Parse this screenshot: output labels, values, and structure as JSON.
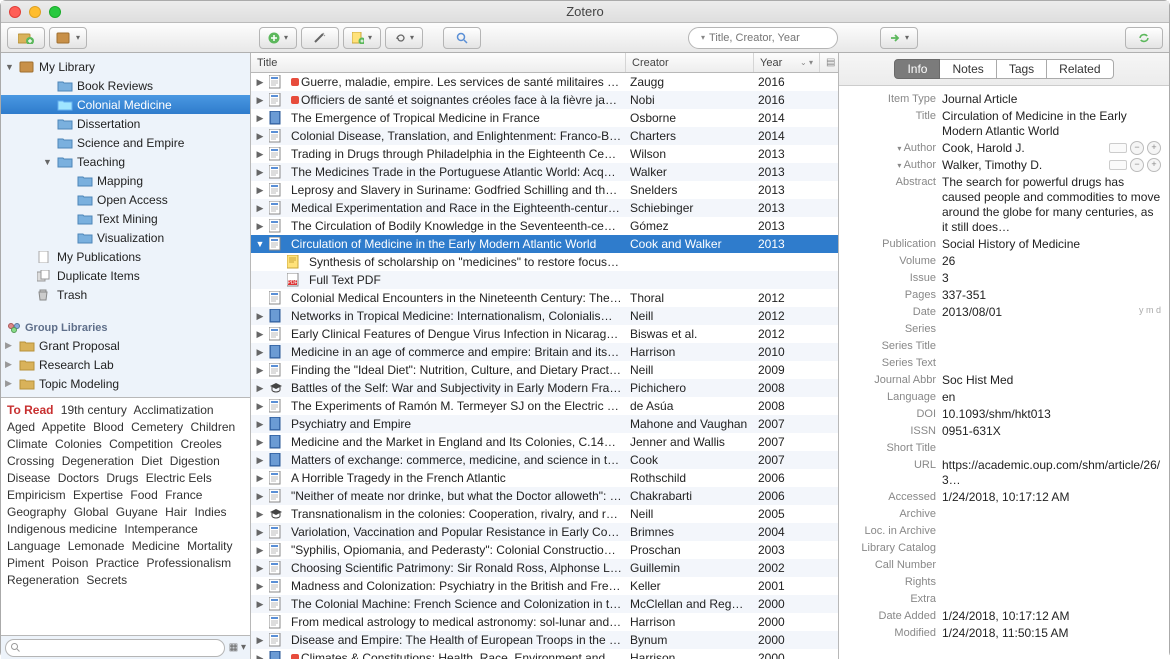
{
  "window_title": "Zotero",
  "toolbar_search_placeholder": "Title, Creator, Year",
  "sidebar": {
    "my_library": "My Library",
    "items": [
      {
        "label": "Book Reviews",
        "depth": 2
      },
      {
        "label": "Colonial Medicine",
        "depth": 2,
        "selected": true
      },
      {
        "label": "Dissertation",
        "depth": 2
      },
      {
        "label": "Science and Empire",
        "depth": 2
      },
      {
        "label": "Teaching",
        "depth": 2,
        "expanded": true
      },
      {
        "label": "Mapping",
        "depth": 3
      },
      {
        "label": "Open Access",
        "depth": 3
      },
      {
        "label": "Text Mining",
        "depth": 3
      },
      {
        "label": "Visualization",
        "depth": 3
      }
    ],
    "my_publications": "My Publications",
    "duplicate_items": "Duplicate Items",
    "trash": "Trash",
    "group_libraries_header": "Group Libraries",
    "groups": [
      {
        "label": "Grant Proposal"
      },
      {
        "label": "Research Lab"
      },
      {
        "label": "Topic Modeling"
      }
    ]
  },
  "tags": [
    "To Read",
    "19th century",
    "Acclimatization",
    "Aged",
    "Appetite",
    "Blood",
    "Cemetery",
    "Children",
    "Climate",
    "Colonies",
    "Competition",
    "Creoles",
    "Crossing",
    "Degeneration",
    "Diet",
    "Digestion",
    "Disease",
    "Doctors",
    "Drugs",
    "Electric Eels",
    "Empiricism",
    "Expertise",
    "Food",
    "France",
    "Geography",
    "Global",
    "Guyane",
    "Hair",
    "Indies",
    "Indigenous medicine",
    "Intemperance",
    "Language",
    "Lemonade",
    "Medicine",
    "Mortality",
    "Piment",
    "Poison",
    "Practice",
    "Professionalism",
    "Regeneration",
    "Secrets"
  ],
  "columns": {
    "title": "Title",
    "creator": "Creator",
    "year": "Year"
  },
  "items": [
    {
      "title": "Guerre, maladie, empire. Les services de santé militaires en …",
      "creator": "Zaugg",
      "year": "2016",
      "icon": "article",
      "dot": true,
      "twisty": true
    },
    {
      "title": "Officiers de santé et soignantes créoles face à la fièvre jaune",
      "creator": "Nobi",
      "year": "2016",
      "icon": "article",
      "dot": true,
      "twisty": true
    },
    {
      "title": "The Emergence of Tropical Medicine in France",
      "creator": "Osborne",
      "year": "2014",
      "icon": "book",
      "twisty": true
    },
    {
      "title": "Colonial Disease, Translation, and Enlightenment: Franco-Briti…",
      "creator": "Charters",
      "year": "2014",
      "icon": "article",
      "twisty": true
    },
    {
      "title": "Trading in Drugs through Philadelphia in the Eighteenth Centu…",
      "creator": "Wilson",
      "year": "2013",
      "icon": "article",
      "twisty": true
    },
    {
      "title": "The Medicines Trade in the Portuguese Atlantic World: Acquisi…",
      "creator": "Walker",
      "year": "2013",
      "icon": "article",
      "twisty": true
    },
    {
      "title": "Leprosy and Slavery in Suriname: Godfried Schilling and the Fr…",
      "creator": "Snelders",
      "year": "2013",
      "icon": "article",
      "twisty": true
    },
    {
      "title": "Medical Experimentation and Race in the Eighteenth-century …",
      "creator": "Schiebinger",
      "year": "2013",
      "icon": "article",
      "twisty": true
    },
    {
      "title": "The Circulation of Bodily Knowledge in the Seventeenth-centu…",
      "creator": "Gómez",
      "year": "2013",
      "icon": "article",
      "twisty": true
    },
    {
      "title": "Circulation of Medicine in the Early Modern Atlantic World",
      "creator": "Cook and Walker",
      "year": "2013",
      "icon": "article",
      "twisty": true,
      "expanded": true,
      "selected": true
    },
    {
      "title": "Synthesis of scholarship on \"medicines\" to restore focus o…",
      "creator": "",
      "year": "",
      "icon": "note",
      "child": true
    },
    {
      "title": "Full Text PDF",
      "creator": "",
      "year": "",
      "icon": "pdf",
      "child": true
    },
    {
      "title": "Colonial Medical Encounters in the Nineteenth Century: The Fr…",
      "creator": "Thoral",
      "year": "2012",
      "icon": "article"
    },
    {
      "title": "Networks in Tropical Medicine: Internationalism, Colonialism, a…",
      "creator": "Neill",
      "year": "2012",
      "icon": "book",
      "twisty": true
    },
    {
      "title": "Early Clinical Features of Dengue Virus Infection in Nicaraguan…",
      "creator": "Biswas et al.",
      "year": "2012",
      "icon": "article",
      "twisty": true
    },
    {
      "title": "Medicine in an age of commerce and empire: Britain and its tr…",
      "creator": "Harrison",
      "year": "2010",
      "icon": "book",
      "twisty": true
    },
    {
      "title": "Finding the \"Ideal Diet\": Nutrition, Culture, and Dietary Practic…",
      "creator": "Neill",
      "year": "2009",
      "icon": "article",
      "twisty": true
    },
    {
      "title": "Battles of the Self: War and Subjectivity in Early Modern France",
      "creator": "Pichichero",
      "year": "2008",
      "icon": "thesis",
      "twisty": true
    },
    {
      "title": "The Experiments of Ramón M. Termeyer SJ on the Electric Eel …",
      "creator": "de Asúa",
      "year": "2008",
      "icon": "article",
      "twisty": true
    },
    {
      "title": "Psychiatry and Empire",
      "creator": "Mahone and Vaughan",
      "year": "2007",
      "icon": "book",
      "twisty": true
    },
    {
      "title": "Medicine and the Market in England and Its Colonies, C.1450-…",
      "creator": "Jenner and Wallis",
      "year": "2007",
      "icon": "book",
      "twisty": true
    },
    {
      "title": "Matters of exchange: commerce, medicine, and science in the…",
      "creator": "Cook",
      "year": "2007",
      "icon": "book",
      "twisty": true
    },
    {
      "title": "A Horrible Tragedy in the French Atlantic",
      "creator": "Rothschild",
      "year": "2006",
      "icon": "article",
      "twisty": true
    },
    {
      "title": "\"Neither of meate nor drinke, but what the Doctor alloweth\": …",
      "creator": "Chakrabarti",
      "year": "2006",
      "icon": "article",
      "twisty": true
    },
    {
      "title": "Transnationalism in the colonies: Cooperation, rivalry, and rac…",
      "creator": "Neill",
      "year": "2005",
      "icon": "thesis",
      "twisty": true
    },
    {
      "title": "Variolation, Vaccination and Popular Resistance in Early Coloni…",
      "creator": "Brimnes",
      "year": "2004",
      "icon": "article",
      "twisty": true
    },
    {
      "title": "\"Syphilis, Opiomania, and Pederasty\": Colonial Constructions …",
      "creator": "Proschan",
      "year": "2003",
      "icon": "article",
      "twisty": true
    },
    {
      "title": "Choosing Scientific Patrimony: Sir Ronald Ross, Alphonse Lav…",
      "creator": "Guillemin",
      "year": "2002",
      "icon": "article",
      "twisty": true
    },
    {
      "title": "Madness and Colonization: Psychiatry in the British and Frenc…",
      "creator": "Keller",
      "year": "2001",
      "icon": "article",
      "twisty": true
    },
    {
      "title": "The Colonial Machine: French Science and Colonization in the …",
      "creator": "McClellan and Rego…",
      "year": "2000",
      "icon": "article",
      "twisty": true
    },
    {
      "title": "From medical astrology to medical astronomy: sol-lunar and pl…",
      "creator": "Harrison",
      "year": "2000",
      "icon": "article"
    },
    {
      "title": "Disease and Empire: The Health of European Troops in the Co…",
      "creator": "Bynum",
      "year": "2000",
      "icon": "article",
      "twisty": true
    },
    {
      "title": "Climates & Constitutions: Health, Race, Environment and …",
      "creator": "Harrison",
      "year": "2000",
      "icon": "book",
      "dot": true,
      "twisty": true
    }
  ],
  "detail": {
    "tabs": {
      "info": "Info",
      "notes": "Notes",
      "tags": "Tags",
      "related": "Related"
    },
    "fields": {
      "item_type": {
        "label": "Item Type",
        "value": "Journal Article"
      },
      "title": {
        "label": "Title",
        "value": "Circulation of Medicine in the Early Modern Atlantic World"
      },
      "author1": {
        "label": "Author",
        "value": "Cook, Harold J."
      },
      "author2": {
        "label": "Author",
        "value": "Walker, Timothy D."
      },
      "abstract": {
        "label": "Abstract",
        "value": "The search for powerful drugs has caused people and commodities to move around the globe for many centuries, as it still does…"
      },
      "publication": {
        "label": "Publication",
        "value": "Social History of Medicine"
      },
      "volume": {
        "label": "Volume",
        "value": "26"
      },
      "issue": {
        "label": "Issue",
        "value": "3"
      },
      "pages": {
        "label": "Pages",
        "value": "337-351"
      },
      "date": {
        "label": "Date",
        "value": "2013/08/01",
        "ymd": "y m d"
      },
      "series": {
        "label": "Series",
        "value": ""
      },
      "series_title": {
        "label": "Series Title",
        "value": ""
      },
      "series_text": {
        "label": "Series Text",
        "value": ""
      },
      "journal_abbr": {
        "label": "Journal Abbr",
        "value": "Soc Hist Med"
      },
      "language": {
        "label": "Language",
        "value": "en"
      },
      "doi": {
        "label": "DOI",
        "value": "10.1093/shm/hkt013"
      },
      "issn": {
        "label": "ISSN",
        "value": "0951-631X"
      },
      "short_title": {
        "label": "Short Title",
        "value": ""
      },
      "url": {
        "label": "URL",
        "value": "https://academic.oup.com/shm/article/26/3…"
      },
      "accessed": {
        "label": "Accessed",
        "value": "1/24/2018, 10:17:12 AM"
      },
      "archive": {
        "label": "Archive",
        "value": ""
      },
      "loc_archive": {
        "label": "Loc. in Archive",
        "value": ""
      },
      "library_catalog": {
        "label": "Library Catalog",
        "value": ""
      },
      "call_number": {
        "label": "Call Number",
        "value": ""
      },
      "rights": {
        "label": "Rights",
        "value": ""
      },
      "extra": {
        "label": "Extra",
        "value": ""
      },
      "date_added": {
        "label": "Date Added",
        "value": "1/24/2018, 10:17:12 AM"
      },
      "modified": {
        "label": "Modified",
        "value": "1/24/2018, 11:50:15 AM"
      }
    }
  }
}
